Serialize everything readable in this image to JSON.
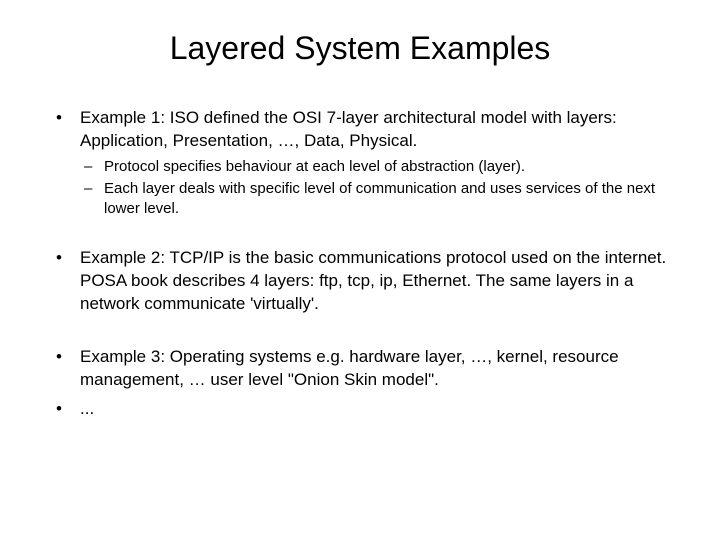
{
  "title": "Layered System Examples",
  "bullets": {
    "b1": "Example 1: ISO defined the OSI 7-layer architectural model with layers: Application, Presentation, …, Data, Physical.",
    "b1_sub1": "Protocol specifies behaviour at each level of abstraction (layer).",
    "b1_sub2": "Each layer deals with specific level of communication and uses services of the next lower level.",
    "b2": "Example 2: TCP/IP is the basic communications protocol used on the internet. POSA book describes 4 layers: ftp, tcp, ip, Ethernet. The same layers in a network communicate 'virtually'.",
    "b3": "Example 3: Operating systems e.g. hardware layer, …, kernel, resource management, … user level \"Onion Skin model\".",
    "b4": "..."
  },
  "markers": {
    "dot": "•",
    "dash": "–"
  }
}
